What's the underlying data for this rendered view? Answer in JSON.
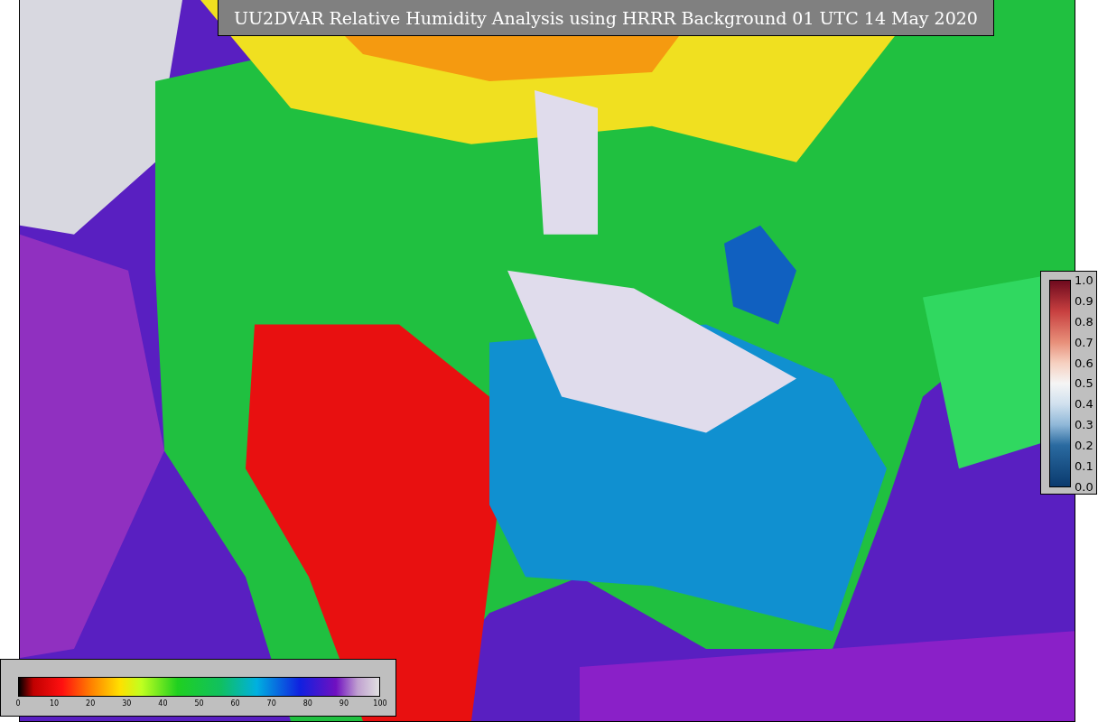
{
  "title": "UU2DVAR Relative Humidity Analysis using HRRR Background 01 UTC 14 May 2020",
  "observation_colorbar": {
    "ticks": [
      "1.0",
      "0.9",
      "0.8",
      "0.7",
      "0.6",
      "0.5",
      "0.4",
      "0.3",
      "0.2",
      "0.1",
      "0.0"
    ]
  },
  "humidity_colorbar": {
    "ticks": [
      "0",
      "10",
      "20",
      "30",
      "40",
      "50",
      "60",
      "70",
      "80",
      "90",
      "100"
    ]
  }
}
